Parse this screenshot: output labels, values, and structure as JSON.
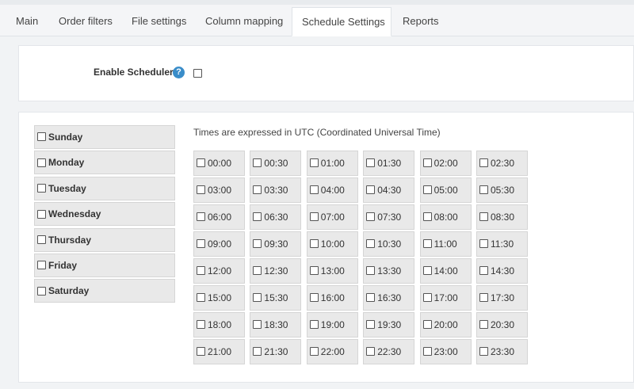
{
  "tabs": [
    {
      "label": "Main",
      "active": false
    },
    {
      "label": "Order filters",
      "active": false
    },
    {
      "label": "File settings",
      "active": false
    },
    {
      "label": "Column mapping",
      "active": false
    },
    {
      "label": "Schedule Settings",
      "active": true
    },
    {
      "label": "Reports",
      "active": false
    }
  ],
  "scheduler": {
    "enable_label": "Enable Scheduler",
    "help_icon": "?",
    "enabled": false
  },
  "days": [
    "Sunday",
    "Monday",
    "Tuesday",
    "Wednesday",
    "Thursday",
    "Friday",
    "Saturday"
  ],
  "utc_note": "Times are expressed in UTC (Coordinated Universal Time)",
  "times": [
    "00:00",
    "00:30",
    "01:00",
    "01:30",
    "02:00",
    "02:30",
    "03:00",
    "03:30",
    "04:00",
    "04:30",
    "05:00",
    "05:30",
    "06:00",
    "06:30",
    "07:00",
    "07:30",
    "08:00",
    "08:30",
    "09:00",
    "09:30",
    "10:00",
    "10:30",
    "11:00",
    "11:30",
    "12:00",
    "12:30",
    "13:00",
    "13:30",
    "14:00",
    "14:30",
    "15:00",
    "15:30",
    "16:00",
    "16:30",
    "17:00",
    "17:30",
    "18:00",
    "18:30",
    "19:00",
    "19:30",
    "20:00",
    "20:30",
    "21:00",
    "21:30",
    "22:00",
    "22:30",
    "23:00",
    "23:30"
  ],
  "colors": {
    "accent": "#3a8dc9",
    "cell_bg": "#e9e9e9"
  }
}
